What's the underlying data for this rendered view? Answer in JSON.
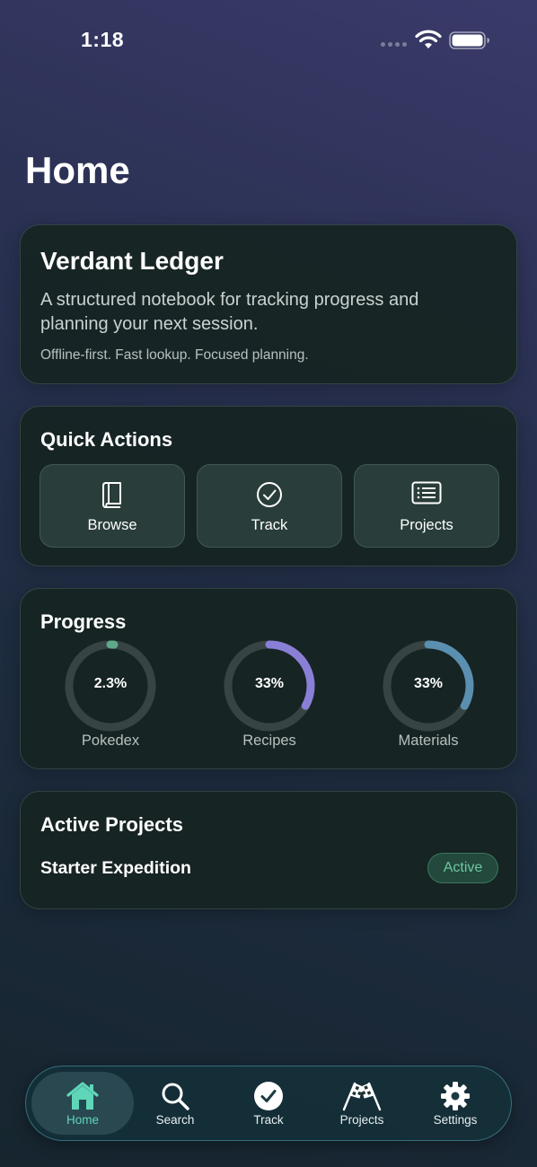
{
  "status_bar": {
    "time": "1:18"
  },
  "page": {
    "title": "Home"
  },
  "intro": {
    "title": "Verdant Ledger",
    "description": "A structured notebook for tracking progress and planning your next session.",
    "note": "Offline-first. Fast lookup. Focused planning."
  },
  "quick_actions": {
    "title": "Quick Actions",
    "items": [
      {
        "label": "Browse",
        "icon": "book-icon"
      },
      {
        "label": "Track",
        "icon": "checkmark-circle-icon"
      },
      {
        "label": "Projects",
        "icon": "list-icon"
      }
    ]
  },
  "progress": {
    "title": "Progress",
    "items": [
      {
        "label": "Pokedex",
        "value_text": "2.3%",
        "fraction": 0.023,
        "color": "#5fa88a"
      },
      {
        "label": "Recipes",
        "value_text": "33%",
        "fraction": 0.33,
        "color": "#8a7fd6"
      },
      {
        "label": "Materials",
        "value_text": "33%",
        "fraction": 0.33,
        "color": "#5b8fb0"
      }
    ]
  },
  "active_projects": {
    "title": "Active Projects",
    "items": [
      {
        "name": "Starter Expedition",
        "status": "Active"
      }
    ]
  },
  "tabbar": {
    "active": "Home",
    "accent": "#5fd6b8",
    "items": [
      {
        "label": "Home",
        "icon": "home-icon"
      },
      {
        "label": "Search",
        "icon": "search-icon"
      },
      {
        "label": "Track",
        "icon": "checkmark-circle-icon"
      },
      {
        "label": "Projects",
        "icon": "checkered-flags-icon"
      },
      {
        "label": "Settings",
        "icon": "gear-icon"
      }
    ]
  }
}
